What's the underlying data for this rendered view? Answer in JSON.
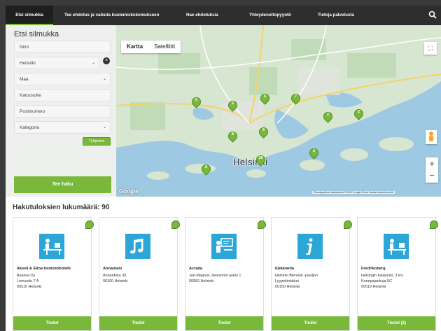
{
  "nav": {
    "items": [
      {
        "label": "Etsi silmukka"
      },
      {
        "label": "Tee ehdotus ja vaikuta kuulemiskokemukseen"
      },
      {
        "label": "Hae ehdotuksia"
      },
      {
        "label": "Yhteydenottopyyntö"
      },
      {
        "label": "Tietoja palvelusta"
      }
    ],
    "search_icon": "search-icon"
  },
  "side": {
    "title": "Etsi silmukka",
    "fields": {
      "name": "Nimi",
      "city": "Helsinki",
      "country": "Maa",
      "street": "Katuosoite",
      "postal": "Postinumero",
      "category": "Kategoria"
    },
    "reset_label": "Tyhjennä",
    "search_label": "Tee haku"
  },
  "map": {
    "tab_map": "Kartta",
    "tab_satellite": "Satelliitti",
    "city": "Helsinki",
    "attribution": "Pikanäppäimet   Karttatiedot ©2024 Google   Ehdot   Ilmoita karttavirheestä",
    "google": "Google",
    "markers": [
      {
        "label": "5"
      },
      {
        "label": "6"
      },
      {
        "label": "6"
      },
      {
        "label": "7"
      },
      {
        "label": "2"
      },
      {
        "label": "2"
      },
      {
        "label": "8"
      },
      {
        "label": "9"
      },
      {
        "label": "26"
      },
      {
        "label": "2"
      },
      {
        "label": "6"
      }
    ],
    "map_color": "#cfe0cb",
    "water_color": "#9ec9e2"
  },
  "results": {
    "title": "Hakutuloksien lukumäärä: 90",
    "cards": [
      {
        "name": "Akseli & Elina toimistohotelli",
        "lines": [
          "Avaava Oy",
          "Lemuntie 7 A",
          "00510 Helsinki"
        ],
        "button": "Tiedot",
        "icon": "desk-icon"
      },
      {
        "name": "Annantalo",
        "lines": [
          "Annankatu 30",
          "00100 Helsinki"
        ],
        "button": "Tiedot",
        "icon": "music-note-icon"
      },
      {
        "name": "Arcada",
        "lines": [
          "Jan-Magnus Janssonin aukio 1",
          "00550 Helsinki"
        ],
        "button": "Tiedot",
        "icon": "classroom-icon"
      },
      {
        "name": "Eteläranta",
        "lines": [
          "Helsinki Biennial -paviljon",
          "Lyypekinlaituri",
          "00150 Helsinki"
        ],
        "button": "Tiedot",
        "icon": "info-icon"
      },
      {
        "name": "Fredrikoberg",
        "lines": [
          "Helsingin kaupunki, 3 krs",
          "Konepajankuja 5C",
          "00510 Helsinki"
        ],
        "button": "Tiedot (2)",
        "icon": "desk-icon"
      }
    ]
  },
  "colors": {
    "accent": "#7ab83c",
    "nav": "#2e2e2e",
    "icon_blue": "#2ba6d6"
  }
}
